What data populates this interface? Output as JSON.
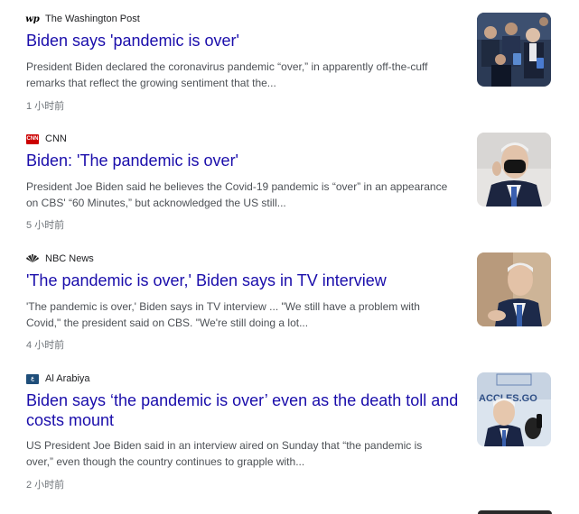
{
  "articles": [
    {
      "source": "The Washington Post",
      "source_icon": "washington-post-logo",
      "headline": "Biden says 'pandemic is over'",
      "snippet_line1": "President Biden declared the coronavirus pandemic “over,” in apparently off-the-cuff",
      "snippet_line2": "remarks that reflect the growing sentiment that the...",
      "time": "1 小时前"
    },
    {
      "source": "CNN",
      "source_icon": "cnn-logo",
      "headline": "Biden: 'The pandemic is over'",
      "snippet_line1": "President Joe Biden said he believes the Covid-19 pandemic is “over” in an appearance",
      "snippet_line2": "on CBS' “60 Minutes,” but acknowledged the US still...",
      "time": "5 小时前"
    },
    {
      "source": "NBC News",
      "source_icon": "nbc-peacock-logo",
      "headline": "'The pandemic is over,' Biden says in TV interview",
      "snippet_line1": "'The pandemic is over,' Biden says in TV interview ... \"We still have a problem with",
      "snippet_line2": "Covid,\" the president said on CBS. \"We're still doing a lot...",
      "time": "4 小时前"
    },
    {
      "source": "Al Arabiya",
      "source_icon": "al-arabiya-logo",
      "headline_line1": "Biden says ‘the pandemic is over’ even as the death toll and",
      "headline_line2": "costs mount",
      "snippet_line1": "US President Joe Biden said in an interview aired on Sunday that “the pandemic is",
      "snippet_line2": "over,” even though the country continues to grapple with...",
      "time": "2 小时前"
    }
  ],
  "thumbnail_texts": {
    "thumb4_sign": "ACCI ES.GO"
  }
}
